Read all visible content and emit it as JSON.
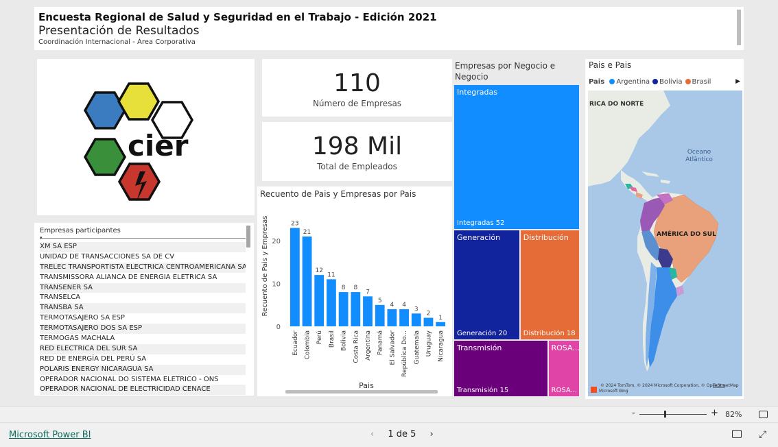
{
  "header": {
    "title": "Encuesta Regional de Salud y Seguridad en el Trabajo - Edición 2021",
    "subtitle": "Presentación de Resultados",
    "org": "Coordinación Internacional - Área Corporativa"
  },
  "logo": {
    "text": "cier",
    "colors": [
      "#3b7cc0",
      "#e8e03a",
      "#ffffff",
      "#3a8f3a",
      "#c8372d"
    ]
  },
  "slicer": {
    "title": "Empresas participantes",
    "items": [
      "XM SA ESP",
      "UNIDAD DE TRANSACCIONES SA DE CV",
      "TRELEC TRANSPORTISTA ELECTRICA CENTROAMERICANA SA",
      "TRANSMISSORA ALIANCA DE ENERGIA ELETRICA SA",
      "TRANSENER SA",
      "TRANSELCA",
      "TRANSBA SA",
      "TERMOTASAJERO SA ESP",
      "TERMOTASAJERO DOS SA ESP",
      "TERMOGAS MACHALA",
      "RED ELECTRICA DEL SUR SA",
      "RED DE ENERGÍA DEL PERÚ SA",
      "POLARIS ENERGY NICARAGUA SA",
      "OPERADOR NACIONAL DO SISTEMA ELETRICO - ONS",
      "OPERADOR NACIONAL DE ELECTRICIDAD CENACE"
    ]
  },
  "kpis": {
    "empresas_value": "110",
    "empresas_label": "Número de Empresas",
    "empleados_value": "198 Mil",
    "empleados_label": "Total de Empleados"
  },
  "chart_data": [
    {
      "type": "bar",
      "title": "Recuento de Pais y Empresas por Pais",
      "xlabel": "Pais",
      "ylabel": "Recuento de Pais y Empresas",
      "categories": [
        "Ecuador",
        "Colombia",
        "Perú",
        "Brasil",
        "Bolivia",
        "Costa Rica",
        "Argentina",
        "Panamá",
        "El Salvador",
        "República Do...",
        "Guatemala",
        "Uruguay",
        "Nicaragua"
      ],
      "values": [
        23,
        21,
        12,
        11,
        8,
        8,
        7,
        5,
        4,
        4,
        3,
        2,
        1
      ],
      "yticks": [
        0,
        10,
        20
      ],
      "ylim": [
        0,
        25
      ],
      "color": "#118dff"
    },
    {
      "type": "treemap",
      "title": "Empresas por Negocio e Negocio",
      "items": [
        {
          "name": "Integradas",
          "label": "Integradas 52",
          "value": 52,
          "color": "#118dff"
        },
        {
          "name": "Generación",
          "label": "Generación 20",
          "value": 20,
          "color": "#12239e"
        },
        {
          "name": "Distribución",
          "label": "Distribución 18",
          "value": 18,
          "color": "#e66c37"
        },
        {
          "name": "Transmisión",
          "label": "Transmisión 15",
          "value": 15,
          "color": "#6b007b"
        },
        {
          "name": "ROSA...",
          "label": "ROSA...",
          "value": 5,
          "color": "#e044a7"
        }
      ]
    }
  ],
  "map": {
    "title": "Pais e Pais",
    "legend_title": "Pais",
    "legend": [
      {
        "name": "Argentina",
        "color": "#118dff"
      },
      {
        "name": "Bolivia",
        "color": "#12239e"
      },
      {
        "name": "Brasil",
        "color": "#e66c37"
      }
    ],
    "labels": {
      "north": "RICA DO NORTE",
      "ocean": "Oceano\nAtlântico",
      "south": "AMÉRICA DO SUL"
    },
    "attribution": "© 2024 TomTom, © 2024 Microsoft Corporation, © OpenStreetMap",
    "terms": "Terms",
    "bing": "Microsoft Bing"
  },
  "zoom": {
    "percent": "82%",
    "minus": "-",
    "plus": "+"
  },
  "footer": {
    "brand": "Microsoft Power BI",
    "page": "1 de 5"
  }
}
